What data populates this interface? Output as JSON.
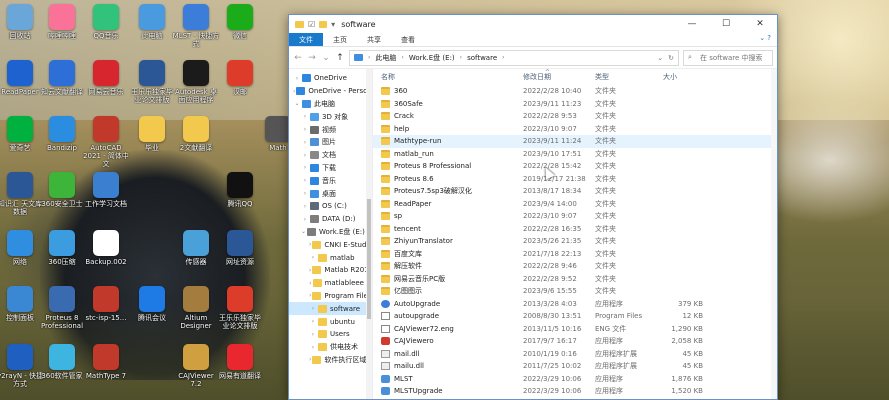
{
  "desktop": {
    "icons": [
      {
        "label": "回收站",
        "icon": "recycle-bin-icon",
        "color": "#6aa6d8"
      },
      {
        "label": "哔哩哔哩",
        "icon": "bilibili-icon",
        "color": "#fb7299"
      },
      {
        "label": "QQ音乐",
        "icon": "qq-music-icon",
        "color": "#31c27c"
      },
      {
        "label": "此电脑",
        "icon": "this-pc-icon",
        "color": "#4a9ae0"
      },
      {
        "label": "MLST - 快捷方式",
        "icon": "mlst-icon",
        "color": "#3b7dd8"
      },
      {
        "label": "微信",
        "icon": "wechat-icon",
        "color": "#1aad19"
      },
      {
        "label": "ReadPaper",
        "icon": "readpaper-icon",
        "color": "#1e62d0"
      },
      {
        "label": "知云文献翻译",
        "icon": "zhiyun-icon",
        "color": "#2d6fd6"
      },
      {
        "label": "网易云音乐",
        "icon": "netease-music-icon",
        "color": "#d8262f"
      },
      {
        "label": "王乐乐独家毕业论文排版",
        "icon": "word-doc-icon",
        "color": "#2b5797"
      },
      {
        "label": "Autodesk 桌面应用程序",
        "icon": "autodesk-icon",
        "color": "#1b1b1b"
      },
      {
        "label": "汉邮",
        "icon": "pdf-icon",
        "color": "#dd3c2b"
      },
      {
        "label": "爱奇艺",
        "icon": "iqiyi-icon",
        "color": "#00b140"
      },
      {
        "label": "Bandizip",
        "icon": "bandizip-icon",
        "color": "#2a8de0"
      },
      {
        "label": "AutoCAD 2021 - 简体中文",
        "icon": "autocad-icon",
        "color": "#c0392b"
      },
      {
        "label": "毕业",
        "icon": "folder-icon",
        "color": "#f2c94c"
      },
      {
        "label": "2文献翻译",
        "icon": "folder-icon",
        "color": "#f2c94c"
      },
      {
        "label": "Math",
        "icon": "math-icon",
        "color": "#555555"
      },
      {
        "label": "知识汇 天文库数据",
        "icon": "word-doc-icon",
        "color": "#2b5797"
      },
      {
        "label": "360安全卫士",
        "icon": "360-security-icon",
        "color": "#3db53b"
      },
      {
        "label": "工作学习文档",
        "icon": "work-docs-icon",
        "color": "#3a7fd0"
      },
      {
        "label": "腾讯QQ",
        "icon": "qq-icon",
        "color": "#111111"
      },
      {
        "label": "网络",
        "icon": "network-icon",
        "color": "#2f8ee0"
      },
      {
        "label": "360压缩",
        "icon": "360-zip-icon",
        "color": "#3b9de0"
      },
      {
        "label": "Backup.002",
        "icon": "backup-file-icon",
        "color": "#ffffff"
      },
      {
        "label": "传感器",
        "icon": "dxf-file-icon",
        "color": "#4aa0d8"
      },
      {
        "label": "网址资源",
        "icon": "word-doc-icon",
        "color": "#2b5797"
      },
      {
        "label": "控制面板",
        "icon": "control-panel-icon",
        "color": "#3a87d4"
      },
      {
        "label": "Proteus 8 Professional",
        "icon": "proteus-icon",
        "color": "#3a6ab0"
      },
      {
        "label": "stc-isp-15...",
        "icon": "stc-isp-icon",
        "color": "#c0392b"
      },
      {
        "label": "腾讯会议",
        "icon": "tencent-meeting-icon",
        "color": "#1e7be6"
      },
      {
        "label": "Altium Designer",
        "icon": "altium-icon",
        "color": "#a47c3d"
      },
      {
        "label": "王乐乐独家毕业论文排版",
        "icon": "pdf-icon",
        "color": "#dd3c2b"
      },
      {
        "label": "v2rayN - 快捷方式",
        "icon": "v2rayn-icon",
        "color": "#1f5fbf"
      },
      {
        "label": "360软件管家",
        "icon": "360-soft-icon",
        "color": "#3db5e0"
      },
      {
        "label": "MathType 7",
        "icon": "mathtype-icon",
        "color": "#c0392b"
      },
      {
        "label": "CAJViewer 7.2",
        "icon": "cajviewer-icon",
        "color": "#d0a040"
      },
      {
        "label": "网易有道翻译",
        "icon": "youdao-icon",
        "color": "#e8272e"
      }
    ]
  },
  "explorer": {
    "title": "software",
    "qa_chevron": "▾",
    "window_buttons": {
      "minimize": "—",
      "maximize": "☐",
      "close": "✕"
    },
    "ribbon_tabs": [
      {
        "label": "文件",
        "active": true
      },
      {
        "label": "主页",
        "active": false
      },
      {
        "label": "共享",
        "active": false
      },
      {
        "label": "查看",
        "active": false
      }
    ],
    "ribbon_right": "⌄ ?",
    "nav_buttons": {
      "back": "←",
      "forward": "→",
      "up_chevron": "⌄",
      "up": "↑"
    },
    "address": {
      "segments": [
        "此电脑",
        "Work.E盘 (E:)",
        "software"
      ],
      "dropdown": "⌄",
      "refresh": "↻"
    },
    "search": {
      "placeholder": "在 software 中搜索",
      "icon": "⌕"
    },
    "nav_pane": [
      {
        "label": "OneDrive",
        "icon": "cloud-icon",
        "exp": "›",
        "color": "#2f86e0"
      },
      {
        "label": "OneDrive - Personal",
        "icon": "cloud-icon",
        "exp": "›",
        "color": "#2f86e0"
      },
      {
        "label": "此电脑",
        "icon": "pc-icon",
        "exp": "⌄",
        "color": "#3f8ee0"
      },
      {
        "label": "3D 对象",
        "icon": "3d-objects-icon",
        "exp": "›",
        "color": "#50a0e8"
      },
      {
        "label": "视频",
        "icon": "video-icon",
        "exp": "›",
        "color": "#6b6b6b"
      },
      {
        "label": "图片",
        "icon": "pictures-icon",
        "exp": "›",
        "color": "#4d90d8"
      },
      {
        "label": "文档",
        "icon": "documents-icon",
        "exp": "›",
        "color": "#888888"
      },
      {
        "label": "下载",
        "icon": "downloads-icon",
        "exp": "›",
        "color": "#2f86e0"
      },
      {
        "label": "音乐",
        "icon": "music-icon",
        "exp": "›",
        "color": "#2f86e0"
      },
      {
        "label": "桌面",
        "icon": "desktop-icon",
        "exp": "›",
        "color": "#3f8ee0"
      },
      {
        "label": "OS (C:)",
        "icon": "drive-icon",
        "exp": "›",
        "color": "#5c6a7a"
      },
      {
        "label": "DATA (D:)",
        "icon": "drive-icon",
        "exp": "›",
        "color": "#7d7d7d"
      },
      {
        "label": "Work.E盘 (E:)",
        "icon": "drive-icon",
        "exp": "⌄",
        "color": "#7d7d7d"
      },
      {
        "label": "CNKI E-Study",
        "icon": "folder-icon",
        "exp": "›",
        "color": "#f2c94c"
      },
      {
        "label": "matlab",
        "icon": "folder-icon",
        "exp": "›",
        "color": "#f2c94c"
      },
      {
        "label": "Matlab R2019",
        "icon": "folder-icon",
        "exp": "›",
        "color": "#f2c94c"
      },
      {
        "label": "matlableee",
        "icon": "folder-icon",
        "exp": "›",
        "color": "#f2c94c"
      },
      {
        "label": "Program Files",
        "icon": "folder-icon",
        "exp": "›",
        "color": "#f2c94c"
      },
      {
        "label": "software",
        "icon": "folder-icon",
        "exp": "›",
        "color": "#f2c94c",
        "selected": true
      },
      {
        "label": "ubuntu",
        "icon": "folder-icon",
        "exp": "›",
        "color": "#f2c94c"
      },
      {
        "label": "Users",
        "icon": "folder-icon",
        "exp": "›",
        "color": "#f2c94c"
      },
      {
        "label": "供电技术",
        "icon": "folder-icon",
        "exp": "›",
        "color": "#f2c94c"
      },
      {
        "label": "软件执行区域",
        "icon": "folder-icon",
        "exp": "›",
        "color": "#f2c94c"
      }
    ],
    "columns": {
      "name": "名称",
      "date": "修改日期",
      "type": "类型",
      "size": "大小",
      "sort_arrow": "^"
    },
    "files": [
      {
        "name": "360",
        "date": "2022/2/28 10:40",
        "type": "文件夹",
        "size": "",
        "icon": "folder"
      },
      {
        "name": "360Safe",
        "date": "2023/9/11 11:23",
        "type": "文件夹",
        "size": "",
        "icon": "folder"
      },
      {
        "name": "Crack",
        "date": "2022/2/28 9:53",
        "type": "文件夹",
        "size": "",
        "icon": "folder"
      },
      {
        "name": "help",
        "date": "2022/3/10 9:07",
        "type": "文件夹",
        "size": "",
        "icon": "folder"
      },
      {
        "name": "Mathtype-run",
        "date": "2023/9/11 11:24",
        "type": "文件夹",
        "size": "",
        "icon": "folder",
        "hover": true
      },
      {
        "name": "matlab_run",
        "date": "2023/9/10 17:51",
        "type": "文件夹",
        "size": "",
        "icon": "folder"
      },
      {
        "name": "Proteus 8 Professional",
        "date": "2022/2/28 15:42",
        "type": "文件夹",
        "size": "",
        "icon": "folder"
      },
      {
        "name": "Proteus 8.6",
        "date": "2019/12/17 21:38",
        "type": "文件夹",
        "size": "",
        "icon": "folder"
      },
      {
        "name": "Proteus7.5sp3破解汉化",
        "date": "2013/8/17 18:34",
        "type": "文件夹",
        "size": "",
        "icon": "folder"
      },
      {
        "name": "ReadPaper",
        "date": "2023/9/4 14:00",
        "type": "文件夹",
        "size": "",
        "icon": "folder"
      },
      {
        "name": "sp",
        "date": "2022/3/10 9:07",
        "type": "文件夹",
        "size": "",
        "icon": "folder"
      },
      {
        "name": "tencent",
        "date": "2022/2/28 16:35",
        "type": "文件夹",
        "size": "",
        "icon": "folder"
      },
      {
        "name": "ZhiyunTranslator",
        "date": "2023/5/26 21:35",
        "type": "文件夹",
        "size": "",
        "icon": "folder"
      },
      {
        "name": "百度文库",
        "date": "2021/7/18 22:13",
        "type": "文件夹",
        "size": "",
        "icon": "folder"
      },
      {
        "name": "解压软件",
        "date": "2022/2/28 9:46",
        "type": "文件夹",
        "size": "",
        "icon": "folder"
      },
      {
        "name": "网易云音乐PC版",
        "date": "2022/2/28 9:52",
        "type": "文件夹",
        "size": "",
        "icon": "folder"
      },
      {
        "name": "亿图图示",
        "date": "2023/9/6 15:55",
        "type": "文件夹",
        "size": "",
        "icon": "folder"
      },
      {
        "name": "AutoUpgrade",
        "date": "2013/3/28 4:03",
        "type": "应用程序",
        "size": "379 KB",
        "icon": "app"
      },
      {
        "name": "autoupgrade",
        "date": "2008/8/30 13:51",
        "type": "Program Files",
        "size": "12 KB",
        "icon": "doc"
      },
      {
        "name": "CAJViewer72.eng",
        "date": "2013/11/5 10:16",
        "type": "ENG 文件",
        "size": "1,290 KB",
        "icon": "doc"
      },
      {
        "name": "CAJViewero",
        "date": "2017/9/7 16:17",
        "type": "应用程序",
        "size": "2,058 KB",
        "icon": "red"
      },
      {
        "name": "mail.dll",
        "date": "2010/1/19 0:16",
        "type": "应用程序扩展",
        "size": "45 KB",
        "icon": "dll"
      },
      {
        "name": "mailu.dll",
        "date": "2011/7/25 10:02",
        "type": "应用程序扩展",
        "size": "45 KB",
        "icon": "dll"
      },
      {
        "name": "MLST",
        "date": "2022/3/29 10:06",
        "type": "应用程序",
        "size": "1,876 KB",
        "icon": "app2"
      },
      {
        "name": "MLSTUpgrade",
        "date": "2022/3/29 10:06",
        "type": "应用程序",
        "size": "1,520 KB",
        "icon": "app2"
      }
    ]
  }
}
